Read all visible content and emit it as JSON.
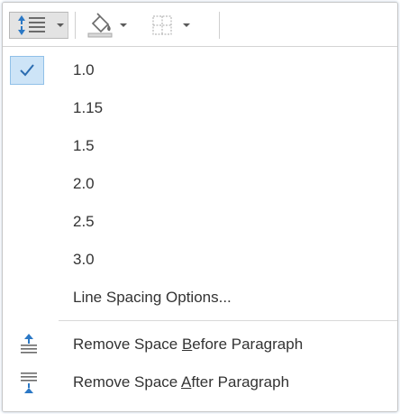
{
  "ribbon": {
    "buttons": [
      {
        "name": "line-spacing-button",
        "icon": "line-spacing-icon"
      },
      {
        "name": "shading-button",
        "icon": "paint-bucket-icon"
      },
      {
        "name": "borders-button",
        "icon": "borders-grid-icon"
      }
    ]
  },
  "menu": {
    "selected": "1.0",
    "spacing_options": [
      "1.0",
      "1.15",
      "1.5",
      "2.0",
      "2.5",
      "3.0"
    ],
    "options_label": "Line Spacing Options...",
    "remove_before": {
      "pre": "Remove Space ",
      "key": "B",
      "post": "efore Paragraph"
    },
    "remove_after": {
      "pre": "Remove Space ",
      "key": "A",
      "post": "fter Paragraph"
    }
  },
  "colors": {
    "accent": "#2b78c5",
    "check": "#2b6cb0",
    "selected_bg": "#cde4f7",
    "selected_border": "#90c0e8",
    "text": "#333333"
  }
}
